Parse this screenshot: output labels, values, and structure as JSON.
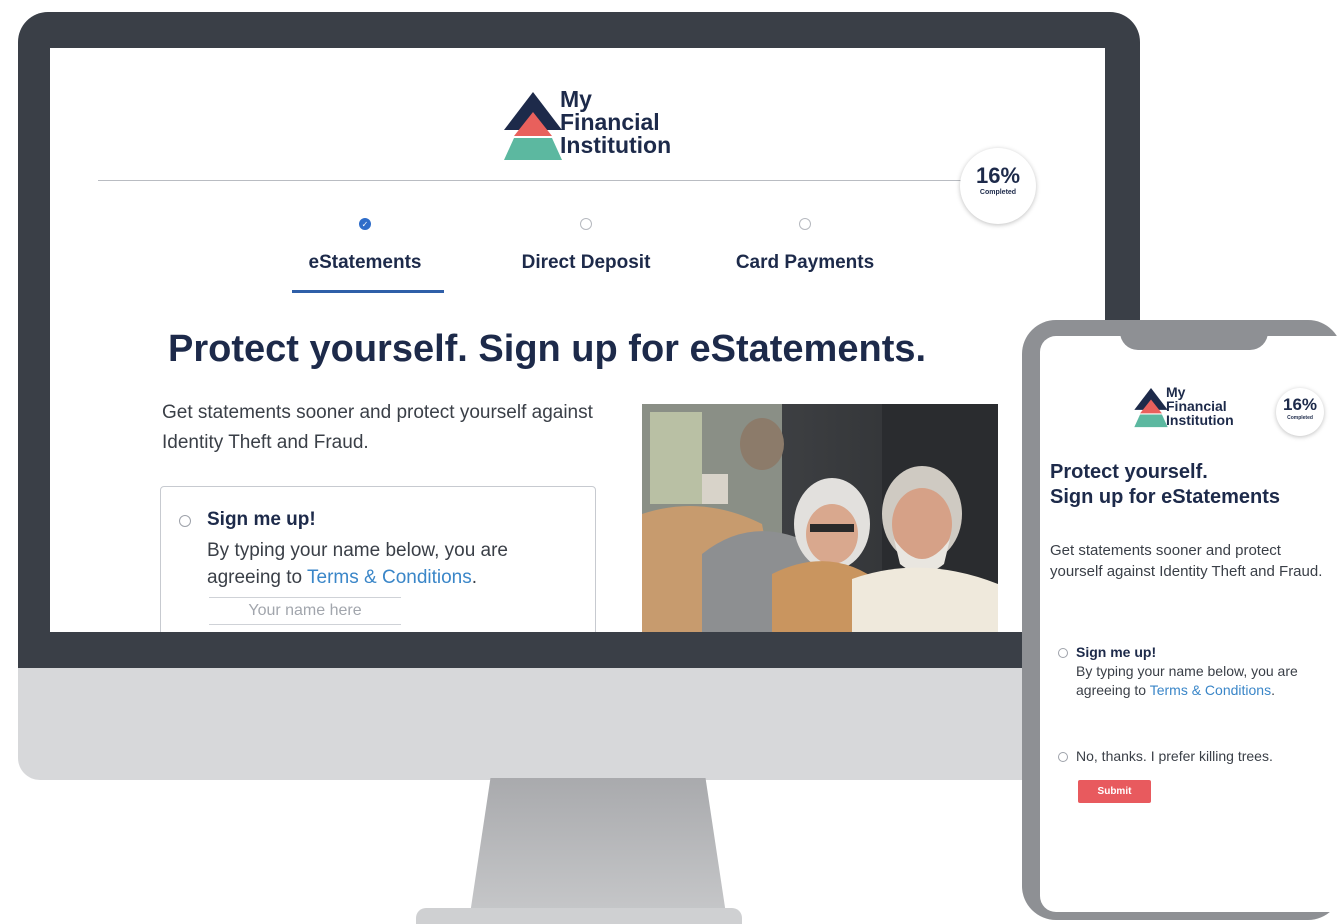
{
  "brand": {
    "line1": "My",
    "line2": "Financial",
    "line3": "Institution",
    "colors": {
      "navy": "#1d2a4a",
      "coral": "#e8605c",
      "teal": "#5cb8a0"
    }
  },
  "progress": {
    "percent_label": "16%",
    "caption": "Completed",
    "value": 0.16
  },
  "steps": [
    {
      "label": "eStatements",
      "status": "complete"
    },
    {
      "label": "Direct Deposit",
      "status": "pending"
    },
    {
      "label": "Card Payments",
      "status": "pending"
    }
  ],
  "desktop": {
    "headline": "Protect yourself. Sign up for eStatements.",
    "body": "Get statements sooner and protect yourself against Identity Theft and Fraud.",
    "option_signup": {
      "title": "Sign me up!",
      "text_before": "By typing your name below, you are agreeing to ",
      "link": "Terms & Conditions",
      "text_after": ".",
      "input_placeholder": "Your name here"
    }
  },
  "mobile": {
    "headline_line1": "Protect yourself.",
    "headline_line2": "Sign up for eStatements",
    "body": "Get statements sooner and protect yourself against Identity Theft and Fraud.",
    "option_signup": {
      "title": "Sign me up!",
      "text_before": "By typing your name below, you are agreeing to ",
      "link": "Terms & Conditions",
      "text_after": "."
    },
    "option_decline": "No, thanks. I prefer killing trees.",
    "submit_label": "Submit",
    "submit_color": "#e85a5e"
  }
}
